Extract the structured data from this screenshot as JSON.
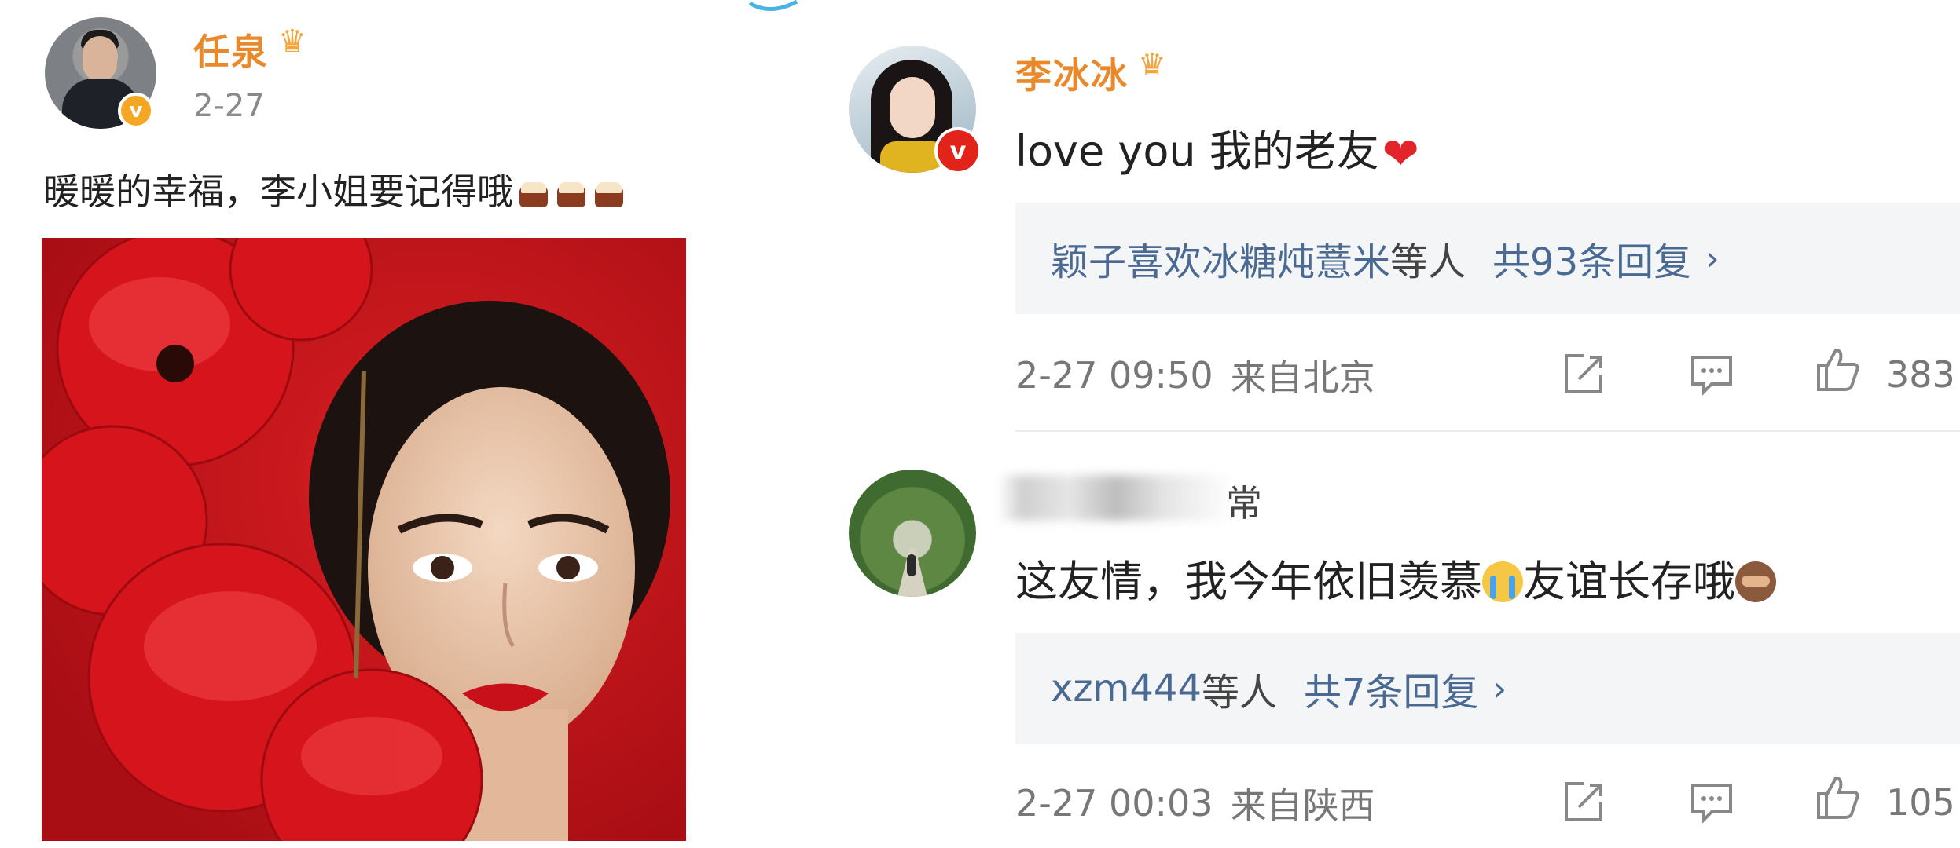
{
  "post": {
    "author": "任泉",
    "date": "2-27",
    "text": "暖暖的幸福，李小姐要记得哦",
    "emoji_icons": [
      "cake-icon",
      "cake-icon",
      "cake-icon"
    ],
    "badge": "v"
  },
  "comments": [
    {
      "author": "李冰冰",
      "text": "love you 我的老友",
      "trailing_icon": "heart-icon",
      "badge": "v",
      "reply_user": "颖子喜欢冰糖炖薏米",
      "reply_suffix": "等人",
      "reply_count": "共93条回复",
      "time": "2-27 09:50",
      "location": "来自北京",
      "likes": "383"
    },
    {
      "author_visible_tail": "常",
      "text_part1": "这友情，我今年依旧羡慕",
      "text_part2": "友谊长存哦",
      "reply_user": "xzm444",
      "reply_suffix": "等人",
      "reply_count": "共7条回复",
      "time": "2-27 00:03",
      "location": "来自陕西",
      "likes": "105"
    }
  ],
  "icons": {
    "crown": "crown-icon",
    "share": "share-icon",
    "comment": "comment-icon",
    "like": "thumbs-up-icon",
    "chevron": "chevron-right-icon"
  },
  "colors": {
    "name_orange": "#e88a2c",
    "link_blue": "#4a6a93",
    "verified_gold": "#f5a623",
    "verified_red": "#e2231a",
    "reply_bg": "#f4f5f6"
  }
}
